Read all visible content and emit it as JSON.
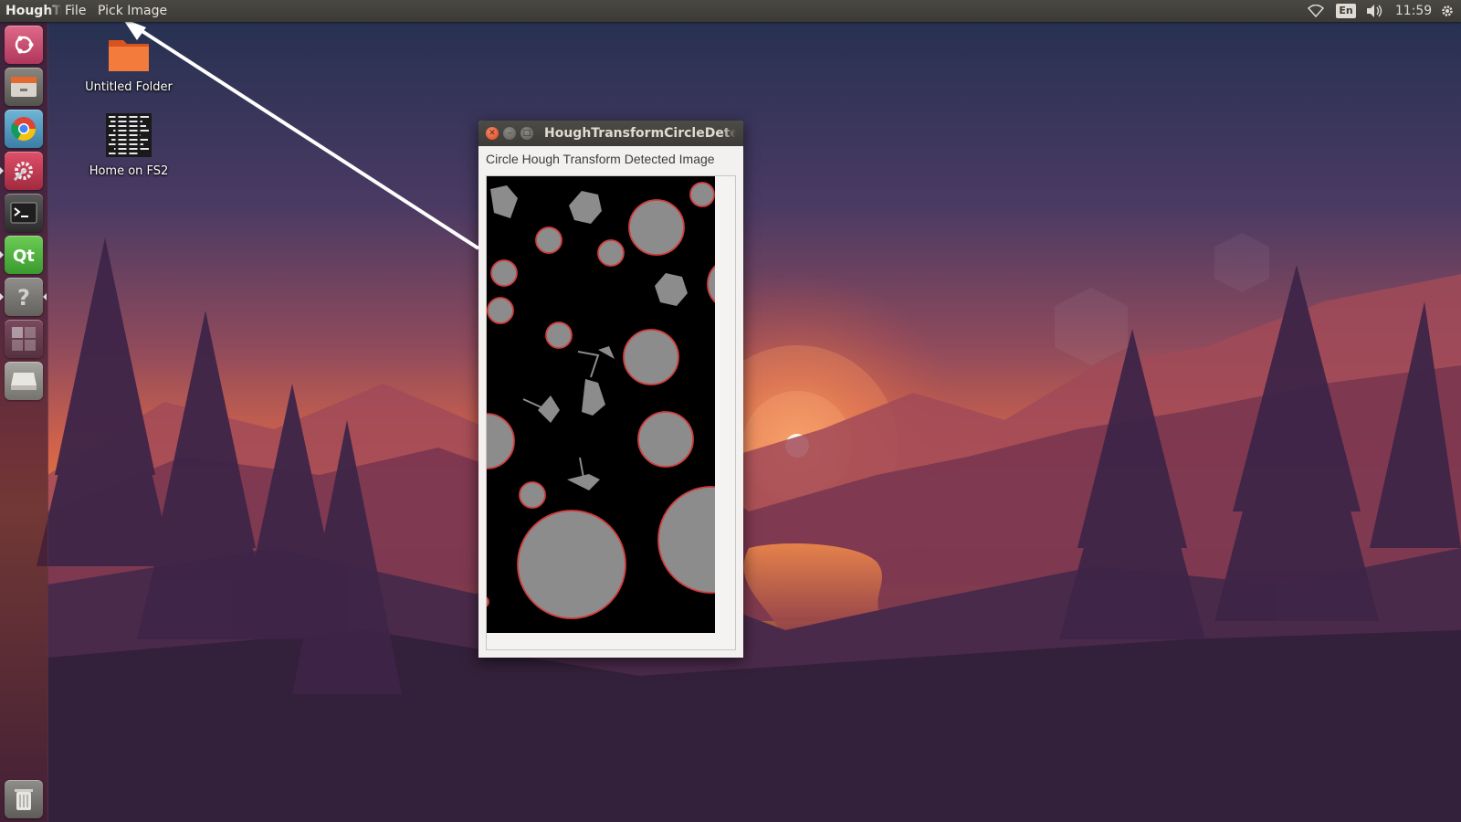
{
  "top_panel": {
    "app_name": "HoughTr",
    "menus": [
      {
        "label": "File"
      },
      {
        "label": "Pick Image"
      }
    ],
    "indicators": {
      "wifi_icon": "wifi-icon",
      "keyboard_layout": "En",
      "sound_icon": "volume-icon",
      "clock": "11:59",
      "session_icon": "gear-icon"
    }
  },
  "launcher": {
    "items": [
      {
        "name": "dash-home",
        "icon": "ubuntu-logo-icon"
      },
      {
        "name": "files",
        "icon": "file-manager-icon"
      },
      {
        "name": "chrome",
        "icon": "chrome-icon"
      },
      {
        "name": "system-settings",
        "icon": "settings-icon"
      },
      {
        "name": "terminal",
        "icon": "terminal-icon"
      },
      {
        "name": "qt-creator",
        "icon": "qt-icon"
      },
      {
        "name": "help",
        "icon": "help-icon"
      },
      {
        "name": "workspace-switcher",
        "icon": "workspace-icon"
      },
      {
        "name": "drive",
        "icon": "drive-icon"
      },
      {
        "name": "trash",
        "icon": "trash-icon"
      }
    ]
  },
  "desktop": {
    "icons": [
      {
        "label": "Untitled Folder",
        "icon": "folder-icon"
      },
      {
        "label": "Home on FS2",
        "icon": "network-share-icon"
      }
    ]
  },
  "window": {
    "title": "HoughTransformCircleDetect",
    "label": "Circle Hough Transform Detected Image",
    "colors": {
      "shape_fill": "#8c8c8c",
      "detection_outline": "#d23c3c",
      "image_background": "#000000"
    }
  }
}
